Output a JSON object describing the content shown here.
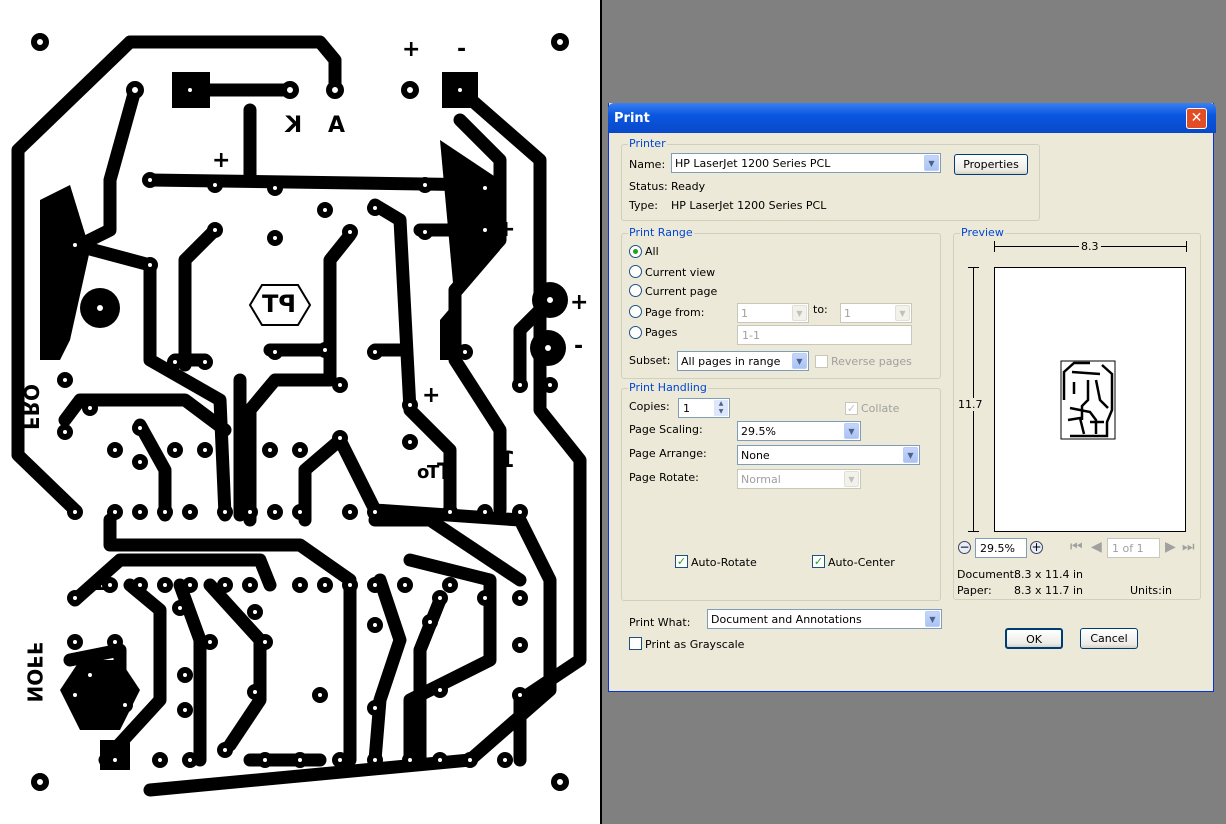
{
  "document": {
    "silk_labels": [
      "+",
      "-",
      "K",
      "A",
      "+",
      "+",
      "+",
      "-",
      "+",
      "PT",
      "FRQ",
      "T",
      "To",
      "1",
      "1",
      "NOFF"
    ]
  },
  "dialog": {
    "title": "Print",
    "close_icon": "close-icon",
    "printer": {
      "group_title": "Printer",
      "name_label": "Name:",
      "name_value": "HP LaserJet 1200 Series PCL",
      "properties_label": "Properties",
      "status_label": "Status:",
      "status_value": "Ready",
      "type_label": "Type:",
      "type_value": "HP LaserJet 1200 Series PCL"
    },
    "print_range": {
      "group_title": "Print Range",
      "all_label": "All",
      "current_view_label": "Current view",
      "current_page_label": "Current page",
      "page_from_label": "Page from:",
      "page_from_value": "1",
      "to_label": "to:",
      "to_value": "1",
      "pages_label": "Pages",
      "pages_placeholder": "1-1",
      "selected": "All",
      "subset_label": "Subset:",
      "subset_value": "All pages in range",
      "reverse_label": "Reverse pages"
    },
    "print_handling": {
      "group_title": "Print Handling",
      "copies_label": "Copies:",
      "copies_value": "1",
      "collate_label": "Collate",
      "scaling_label": "Page Scaling:",
      "scaling_value": "29.5%",
      "arrange_label": "Page Arrange:",
      "arrange_value": "None",
      "rotate_label": "Page Rotate:",
      "rotate_value": "Normal",
      "auto_rotate_label": "Auto-Rotate",
      "auto_center_label": "Auto-Center"
    },
    "preview": {
      "group_title": "Preview",
      "width_value": "8.3",
      "height_value": "11.7",
      "zoom_value": "29.5%",
      "page_indicator": "1 of 1",
      "document_label": "Document:",
      "document_value": "8.3 x 11.4 in",
      "paper_label": "Paper:",
      "paper_value": "8.3 x 11.7 in",
      "units_label": "Units:",
      "units_value": "in"
    },
    "print_what_label": "Print What:",
    "print_what_value": "Document and Annotations",
    "grayscale_label": "Print as Grayscale",
    "ok_label": "OK",
    "cancel_label": "Cancel"
  }
}
